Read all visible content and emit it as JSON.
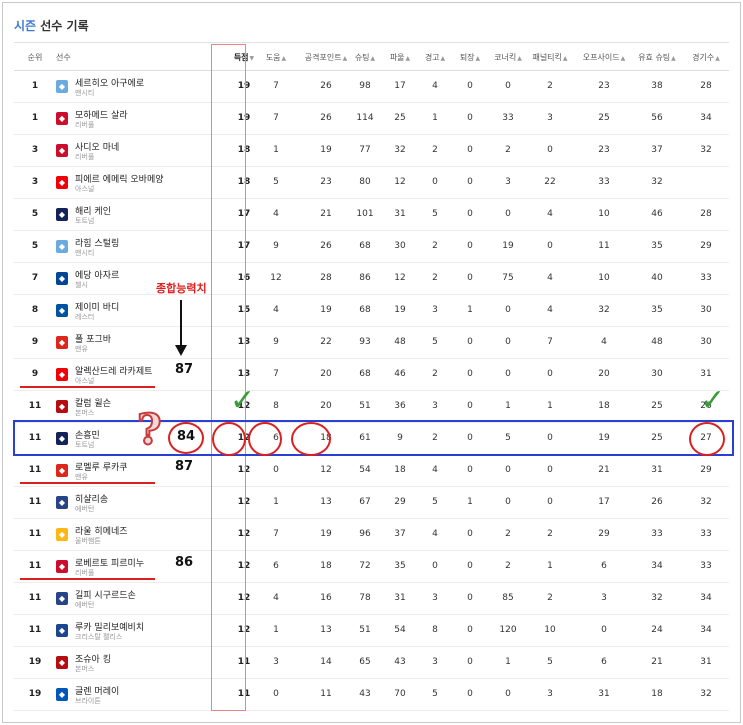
{
  "title": {
    "season": "시즌",
    "rest": " 선수 기록"
  },
  "columns": [
    "순위",
    "선수",
    "득점",
    "도움",
    "공격포인트",
    "슈팅",
    "파울",
    "경고",
    "퇴장",
    "코너킥",
    "패널티킥",
    "오프사이드",
    "유효 슈팅",
    "경기수"
  ],
  "rows": [
    {
      "rank": "1",
      "name": "세르히오 아구에로",
      "team": "맨시티",
      "crest": "MC",
      "color": "#6cabdd",
      "stats": [
        "19",
        "7",
        "26",
        "98",
        "17",
        "4",
        "0",
        "0",
        "2",
        "23",
        "38",
        "28"
      ]
    },
    {
      "rank": "1",
      "name": "모하메드 살라",
      "team": "리버풀",
      "crest": "LV",
      "color": "#c8102e",
      "stats": [
        "19",
        "7",
        "26",
        "114",
        "25",
        "1",
        "0",
        "33",
        "3",
        "25",
        "56",
        "34"
      ]
    },
    {
      "rank": "3",
      "name": "사디오 마네",
      "team": "리버풀",
      "crest": "LV",
      "color": "#c8102e",
      "stats": [
        "18",
        "1",
        "19",
        "77",
        "32",
        "2",
        "0",
        "2",
        "0",
        "23",
        "37",
        "32"
      ]
    },
    {
      "rank": "3",
      "name": "피에르 에메릭 오바메양",
      "team": "아스널",
      "crest": "AR",
      "color": "#ef0107",
      "stats": [
        "18",
        "5",
        "23",
        "80",
        "12",
        "0",
        "0",
        "3",
        "22",
        "33",
        "32",
        ""
      ]
    },
    {
      "rank": "5",
      "name": "해리 케인",
      "team": "토트넘",
      "crest": "TH",
      "color": "#132257",
      "stats": [
        "17",
        "4",
        "21",
        "101",
        "31",
        "5",
        "0",
        "0",
        "4",
        "10",
        "46",
        "28"
      ]
    },
    {
      "rank": "5",
      "name": "라힘 스털링",
      "team": "맨시티",
      "crest": "MC",
      "color": "#6cabdd",
      "stats": [
        "17",
        "9",
        "26",
        "68",
        "30",
        "2",
        "0",
        "19",
        "0",
        "11",
        "35",
        "29"
      ]
    },
    {
      "rank": "7",
      "name": "에당 아자르",
      "team": "첼시",
      "crest": "CH",
      "color": "#034694",
      "stats": [
        "16",
        "12",
        "28",
        "86",
        "12",
        "2",
        "0",
        "75",
        "4",
        "10",
        "40",
        "33"
      ]
    },
    {
      "rank": "8",
      "name": "제이미 바디",
      "team": "레스터",
      "crest": "LE",
      "color": "#0053a0",
      "stats": [
        "15",
        "4",
        "19",
        "68",
        "19",
        "3",
        "1",
        "0",
        "4",
        "32",
        "35",
        "30"
      ]
    },
    {
      "rank": "9",
      "name": "폴 포그바",
      "team": "맨유",
      "crest": "MU",
      "color": "#da291c",
      "stats": [
        "13",
        "9",
        "22",
        "93",
        "48",
        "5",
        "0",
        "0",
        "7",
        "4",
        "48",
        "30"
      ]
    },
    {
      "rank": "9",
      "name": "알렉산드레 라카제트",
      "team": "아스널",
      "crest": "AR",
      "color": "#ef0107",
      "stats": [
        "13",
        "7",
        "20",
        "68",
        "46",
        "2",
        "0",
        "0",
        "0",
        "20",
        "30",
        "31"
      ]
    },
    {
      "rank": "11",
      "name": "칼럼 윌슨",
      "team": "본머스",
      "crest": "BO",
      "color": "#b50e12",
      "stats": [
        "12",
        "8",
        "20",
        "51",
        "36",
        "3",
        "0",
        "1",
        "1",
        "18",
        "25",
        "26"
      ]
    },
    {
      "rank": "11",
      "name": "손흥민",
      "team": "토트넘",
      "crest": "TH",
      "color": "#132257",
      "stats": [
        "12",
        "6",
        "18",
        "61",
        "9",
        "2",
        "0",
        "5",
        "0",
        "19",
        "25",
        "27"
      ]
    },
    {
      "rank": "11",
      "name": "로멜루 루카쿠",
      "team": "맨유",
      "crest": "MU",
      "color": "#da291c",
      "stats": [
        "12",
        "0",
        "12",
        "54",
        "18",
        "4",
        "0",
        "0",
        "0",
        "21",
        "31",
        "29"
      ]
    },
    {
      "rank": "11",
      "name": "히샬리송",
      "team": "에버턴",
      "crest": "EV",
      "color": "#274488",
      "stats": [
        "12",
        "1",
        "13",
        "67",
        "29",
        "5",
        "1",
        "0",
        "0",
        "17",
        "26",
        "32"
      ]
    },
    {
      "rank": "11",
      "name": "라울 히메네즈",
      "team": "울버햄튼",
      "crest": "WO",
      "color": "#fdb913",
      "stats": [
        "12",
        "7",
        "19",
        "96",
        "37",
        "4",
        "0",
        "2",
        "2",
        "29",
        "33",
        "33"
      ]
    },
    {
      "rank": "11",
      "name": "로베르토 피르미누",
      "team": "리버풀",
      "crest": "LV",
      "color": "#c8102e",
      "stats": [
        "12",
        "6",
        "18",
        "72",
        "35",
        "0",
        "0",
        "2",
        "1",
        "6",
        "34",
        "33"
      ]
    },
    {
      "rank": "11",
      "name": "길피 시구르드손",
      "team": "에버턴",
      "crest": "EV",
      "color": "#274488",
      "stats": [
        "12",
        "4",
        "16",
        "78",
        "31",
        "3",
        "0",
        "85",
        "2",
        "3",
        "32",
        "34"
      ]
    },
    {
      "rank": "11",
      "name": "루카 밀리보예비치",
      "team": "크리스탈 팰리스",
      "crest": "CP",
      "color": "#1b458f",
      "stats": [
        "12",
        "1",
        "13",
        "51",
        "54",
        "8",
        "0",
        "120",
        "10",
        "0",
        "24",
        "34"
      ]
    },
    {
      "rank": "19",
      "name": "조슈아 킹",
      "team": "본머스",
      "crest": "BO",
      "color": "#b50e12",
      "stats": [
        "11",
        "3",
        "14",
        "65",
        "43",
        "3",
        "0",
        "1",
        "5",
        "6",
        "21",
        "31"
      ]
    },
    {
      "rank": "19",
      "name": "글렌 머레이",
      "team": "브라이튼",
      "crest": "BR",
      "color": "#0057b8",
      "stats": [
        "11",
        "0",
        "11",
        "43",
        "70",
        "5",
        "0",
        "0",
        "3",
        "31",
        "18",
        "32"
      ]
    }
  ],
  "annotations": {
    "ability_label": "종합능력치",
    "question": "?",
    "check": "✓",
    "scores": {
      "lacazette": "87",
      "son": "84",
      "lukaku": "87",
      "firmino": "86"
    }
  }
}
